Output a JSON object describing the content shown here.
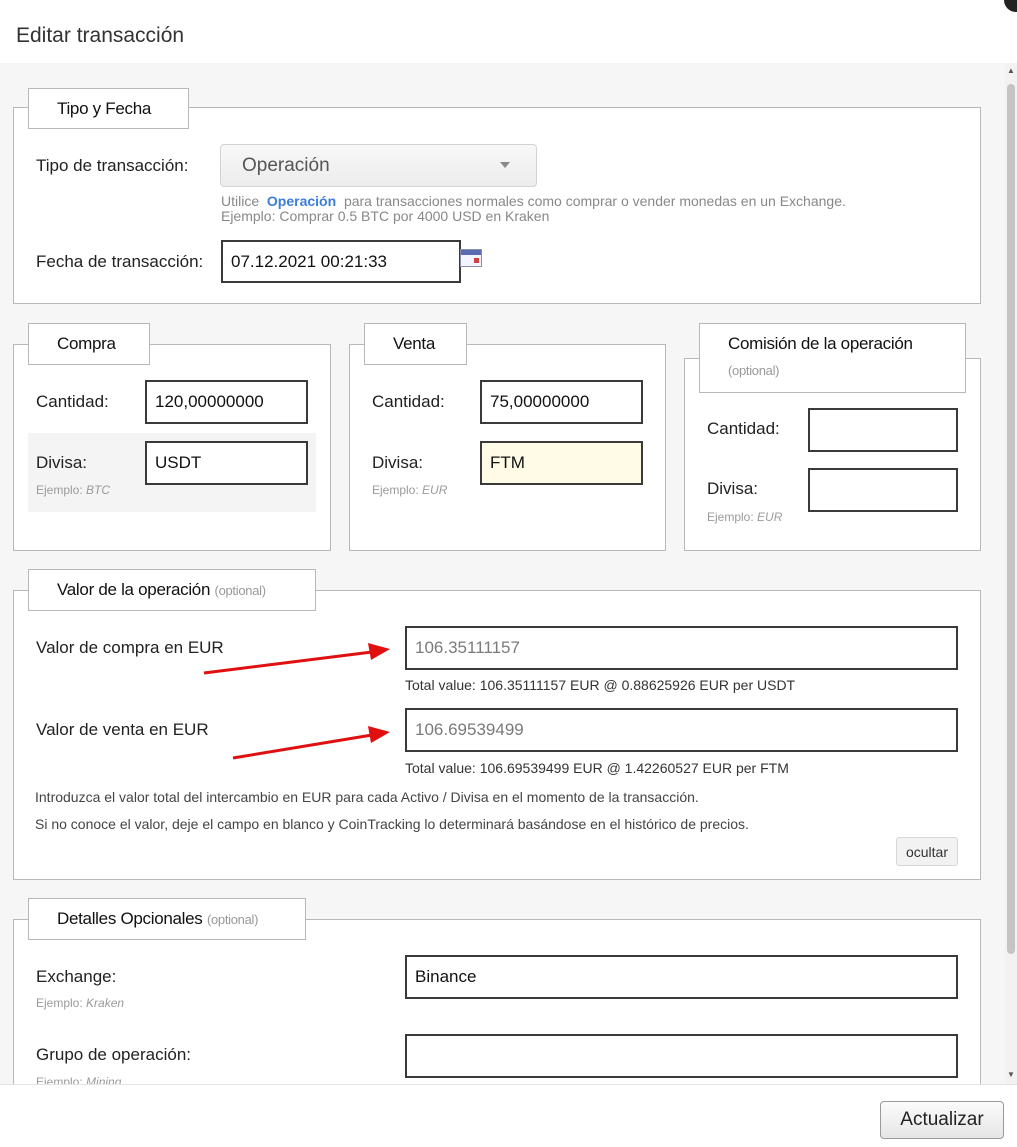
{
  "dialog": {
    "title": "Editar transacción",
    "update_button": "Actualizar"
  },
  "type_date": {
    "legend": "Tipo y Fecha",
    "type_label": "Tipo de transacción:",
    "type_value": "Operación",
    "hint_prefix": "Utilice",
    "hint_keyword": "Operación",
    "hint_suffix": "para transacciones normales como comprar o vender monedas en un Exchange.",
    "hint_example": "Ejemplo: Comprar 0.5 BTC por 4000 USD en Kraken",
    "date_label": "Fecha de transacción:",
    "date_value": "07.12.2021 00:21:33"
  },
  "buy": {
    "legend": "Compra",
    "amount_label": "Cantidad:",
    "amount_value": "120,00000000",
    "currency_label": "Divisa:",
    "currency_value": "USDT",
    "example_prefix": "Ejemplo:",
    "example_value": "BTC"
  },
  "sell": {
    "legend": "Venta",
    "amount_label": "Cantidad:",
    "amount_value": "75,00000000",
    "currency_label": "Divisa:",
    "currency_value": "FTM",
    "example_prefix": "Ejemplo:",
    "example_value": "EUR"
  },
  "fee": {
    "legend": "Comisión de la operación",
    "legend_optional": "(optional)",
    "amount_label": "Cantidad:",
    "amount_value": "",
    "currency_label": "Divisa:",
    "currency_value": "",
    "example_prefix": "Ejemplo:",
    "example_value": "EUR"
  },
  "trade_value": {
    "legend": "Valor de la operación",
    "legend_optional": "(optional)",
    "buy_label": "Valor de compra en EUR",
    "buy_placeholder": "106.35111157",
    "buy_total": "Total value: 106.35111157 EUR @ 0.88625926 EUR per USDT",
    "sell_label": "Valor de venta en EUR",
    "sell_placeholder": "106.69539499",
    "sell_total": "Total value: 106.69539499 EUR @ 1.42260527 EUR per FTM",
    "note1": "Introduzca el valor total del intercambio en EUR para cada Activo / Divisa en el momento de la transacción.",
    "note2": "Si no conoce el valor, deje el campo en blanco y CoinTracking lo determinará basándose en el histórico de precios.",
    "hide_button": "ocultar",
    "arrow_color": "#e01010"
  },
  "optional_details": {
    "legend": "Detalles Opcionales",
    "legend_optional": "(optional)",
    "exchange_label": "Exchange:",
    "exchange_value": "Binance",
    "exchange_example_prefix": "Ejemplo:",
    "exchange_example_value": "Kraken",
    "group_label": "Grupo de operación:",
    "group_value": "",
    "group_example_prefix": "Ejemplo:",
    "group_example_value": "Mining"
  }
}
